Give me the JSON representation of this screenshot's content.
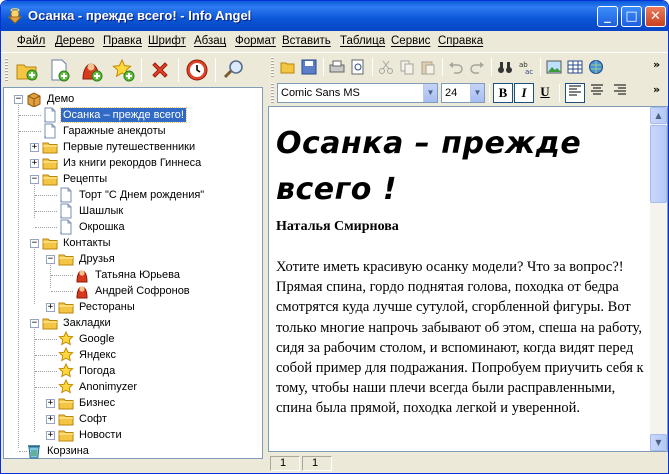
{
  "window": {
    "title": "Осанка - прежде всего! - Info Angel"
  },
  "menu": [
    "Файл",
    "Дерево",
    "Правка",
    "Шрифт",
    "Абзац",
    "Формат",
    "Вставить",
    "Таблица",
    "Сервис",
    "Справка"
  ],
  "tree": {
    "root": "Демо",
    "selected": "Осанка – прежде всего!",
    "items": {
      "osanka": "Осанка – прежде всего!",
      "anekdoty": "Гаражные анекдоты",
      "puteshestvenniki": "Первые путешественники",
      "ginnes": "Из книги рекордов Гиннеса",
      "recepty": "Рецепты",
      "tort": "Торт \"С Днем рождения\"",
      "shashlyk": "Шашлык",
      "okroshka": "Окрошка",
      "kontakty": "Контакты",
      "druzya": "Друзья",
      "yurieva": "Татьяна Юрьева",
      "sofronov": "Андрей Софронов",
      "restorany": "Рестораны",
      "zakladki": "Закладки",
      "google": "Google",
      "yandex": "Яндекс",
      "pogoda": "Погода",
      "anonimyzer": "Anonimyzer",
      "biznes": "Бизнес",
      "soft": "Софт",
      "novosti": "Новости",
      "korzina": "Корзина"
    }
  },
  "format": {
    "font": "Comic Sans MS",
    "size": "24",
    "bold": "B",
    "italic": "I",
    "underline": "U"
  },
  "document": {
    "title": "Осанка – прежде всего !",
    "author": "Наталья Смирнова",
    "body": "Хотите иметь красивую осанку модели? Что за вопрос?! Прямая спина, гордо поднятая голова, походка от бедра смотрятся куда лучше сутулой, сгорбленной фигуры. Вот только многие напрочь забывают об этом, спеша на работу, сидя за рабочим столом, и вспоминают, когда видят перед собой пример для подражания. Попробуем приучить себя к тому, чтобы наши плечи всегда были расправленными, спина была прямой, походка легкой и уверенной."
  },
  "status": {
    "line": "1",
    "col": "1"
  },
  "colors": {
    "title_bar": "#0a56d6",
    "selection": "#316ac5",
    "folder": "#f4c542"
  }
}
